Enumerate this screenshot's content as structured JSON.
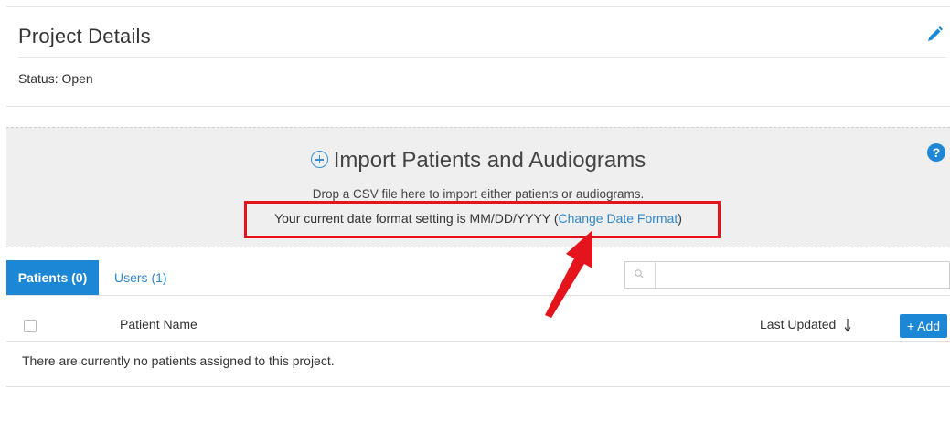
{
  "project": {
    "title": "Project Details",
    "status": "Status: Open"
  },
  "import": {
    "title": "Import Patients and Audiograms",
    "drop_text": "Drop a CSV file here to import either patients or audiograms.",
    "date_text": "Your current date format setting is MM/DD/YYYY (",
    "date_link": "Change Date Format",
    "date_close": ")",
    "help": "?"
  },
  "tabs": [
    {
      "label": "Patients (0)",
      "active": true
    },
    {
      "label": "Users (1)",
      "active": false
    }
  ],
  "search": {
    "placeholder": ""
  },
  "table": {
    "columns": [
      "Patient Name",
      "Last Updated"
    ],
    "add_label": "+ Add",
    "empty_message": "There are currently no patients assigned to this project."
  },
  "colors": {
    "accent": "#1c88d5",
    "link": "#2f87cc",
    "highlight": "#e3141b"
  },
  "icons": [
    "edit-pencil-icon",
    "plus-circle-icon",
    "help-icon",
    "search-icon",
    "sort-down-icon",
    "annotation-arrow"
  ]
}
